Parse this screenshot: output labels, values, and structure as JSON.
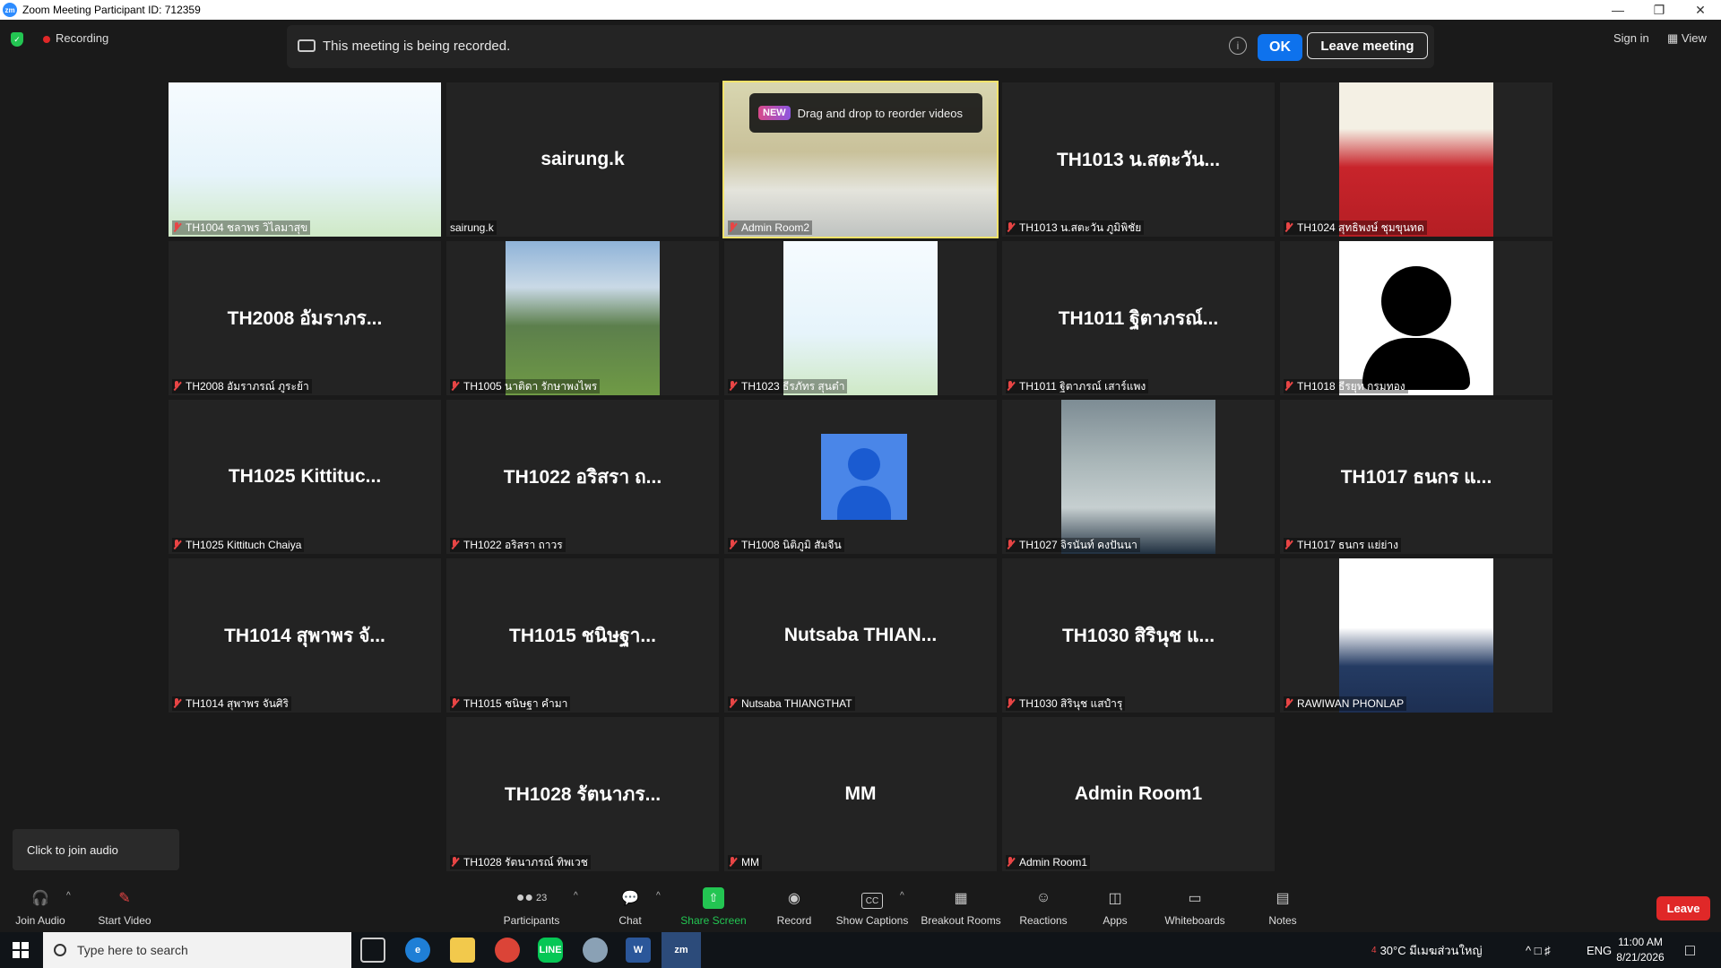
{
  "window": {
    "title": "Zoom Meeting Participant ID: 712359",
    "logo_text": "zm",
    "controls": [
      "minimize",
      "restore",
      "close"
    ]
  },
  "top": {
    "recording_label": "Recording",
    "banner_text": "This meeting is being recorded.",
    "ok_label": "OK",
    "leave_meeting_label": "Leave meeting",
    "signin_label": "Sign in",
    "view_label": "View"
  },
  "drag_tip": {
    "badge": "NEW",
    "text": "Drag and drop to reorder videos"
  },
  "tiles": [
    {
      "center": "",
      "label": "TH1004 ชลาพร วิไลมาสุข"
    },
    {
      "center": "sairung.k",
      "label": "sairung.k"
    },
    {
      "center": "",
      "label": "Admin Room2"
    },
    {
      "center": "TH1013 น.สตะวัน...",
      "label": "TH1013 น.สตะวัน ภูมิพิชัย"
    },
    {
      "center": "",
      "label": "TH1024 สุทธิพงษ์ ชุมขุนทด"
    },
    {
      "center": "TH2008 อัมราภร...",
      "label": "TH2008 อัมราภรณ์ ภูระย้า"
    },
    {
      "center": "",
      "label": "TH1005 นาติดา รักษาพงไพร"
    },
    {
      "center": "",
      "label": "TH1023 ธีรภัทร สุนต๋า"
    },
    {
      "center": "TH1011 ฐิตาภรณ์...",
      "label": "TH1011 ฐิตาภรณ์ เสาร์แพง"
    },
    {
      "center": "",
      "label": "TH1018 ธีรยุท กรมทอง"
    },
    {
      "center": "TH1025 Kittituc...",
      "label": "TH1025 Kittituch Chaiya"
    },
    {
      "center": "TH1022 อริสรา ถ...",
      "label": "TH1022 อริสรา ถาวร"
    },
    {
      "center": "",
      "label": "TH1008 นิติภูมิ สัมจีน"
    },
    {
      "center": "",
      "label": "TH1027 จิรนันท์ คงปันนา"
    },
    {
      "center": "TH1017 ธนกร แ...",
      "label": "TH1017 ธนกร แย่ย่าง"
    },
    {
      "center": "TH1014 สุพาพร จั...",
      "label": "TH1014 สุพาพร จันศิริ"
    },
    {
      "center": "TH1015 ชนิษฐา...",
      "label": "TH1015 ชนิษฐา คำมา"
    },
    {
      "center": "Nutsaba  THIAN...",
      "label": "Nutsaba THIANGTHAT"
    },
    {
      "center": "TH1030 สิรินุช แ...",
      "label": "TH1030 สิรินุช แสปำรุ"
    },
    {
      "center": "",
      "label": "RAWIWAN PHONLAP"
    },
    {
      "center": "TH1028 รัตนาภร...",
      "label": "TH1028 รัตนาภรณ์ ทิพเวช"
    },
    {
      "center": "MM",
      "label": "MM"
    },
    {
      "center": "Admin Room1",
      "label": "Admin Room1"
    }
  ],
  "audio_hint": "Click to join audio",
  "toolbar": {
    "join_audio": "Join Audio",
    "start_video": "Start Video",
    "participants": "Participants",
    "participants_count": "23",
    "chat": "Chat",
    "share_screen": "Share Screen",
    "record": "Record",
    "show_captions": "Show Captions",
    "breakout_rooms": "Breakout Rooms",
    "reactions": "Reactions",
    "apps": "Apps",
    "whiteboards": "Whiteboards",
    "notes": "Notes",
    "leave": "Leave"
  },
  "taskbar": {
    "search_placeholder": "Type here to search",
    "weather": "30°C มีเมฆส่วนใหญ่",
    "lang": "ENG",
    "time": "11:00 AM",
    "date": "8/21/2026",
    "weather_badge": "4"
  },
  "colors": {
    "accent_blue": "#0e72ed",
    "leave_red": "#e02828",
    "share_green": "#23c552",
    "active_border": "#f5e36a"
  }
}
